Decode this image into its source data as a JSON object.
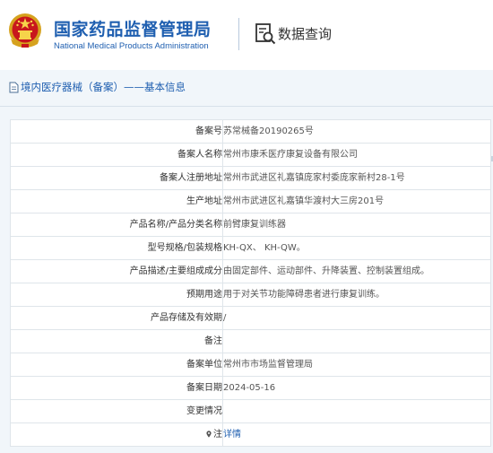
{
  "header": {
    "title_cn": "国家药品监督管理局",
    "title_en": "National Medical Products Administration",
    "query_label": "数据查询",
    "emblem_icon": "national-emblem-icon",
    "query_icon": "data-query-icon",
    "brand_color": "#1f5fb0"
  },
  "breadcrumb": {
    "text": "境内医疗器械（备案）——基本信息",
    "icon": "document-icon"
  },
  "details": [
    {
      "label": "备案号",
      "value": "苏常械备20190265号"
    },
    {
      "label": "备案人名称",
      "value": "常州市康禾医疗康复设备有限公司"
    },
    {
      "label": "备案人注册地址",
      "value": "常州市武进区礼嘉镇庞家村委庞家新村28-1号"
    },
    {
      "label": "生产地址",
      "value": "常州市武进区礼嘉镇华渡村大三房201号"
    },
    {
      "label": "产品名称/产品分类名称",
      "value": "前臂康复训练器"
    },
    {
      "label": "型号规格/包装规格",
      "value": "KH-QX、 KH-QW。"
    },
    {
      "label": "产品描述/主要组成成分",
      "value": "由固定部件、运动部件、升降装置、控制装置组成。"
    },
    {
      "label": "预期用途",
      "value": "用于对关节功能障碍患者进行康复训练。"
    },
    {
      "label": "产品存储及有效期",
      "value": "/"
    },
    {
      "label": "备注",
      "value": ""
    },
    {
      "label": "备案单位",
      "value": "常州市市场监督管理局"
    },
    {
      "label": "备案日期",
      "value": "2024-05-16"
    },
    {
      "label": "变更情况",
      "value": ""
    },
    {
      "label": "注",
      "value": "详情",
      "icon": "location-pin-icon"
    }
  ]
}
